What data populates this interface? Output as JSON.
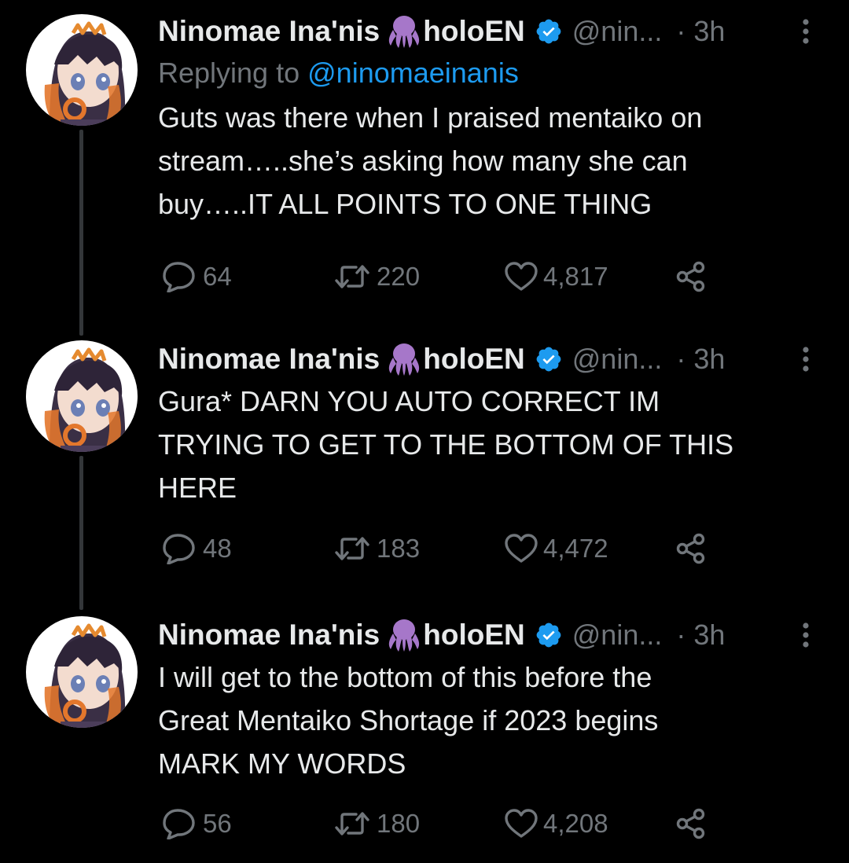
{
  "colors": {
    "background": "#000000",
    "text": "#e7e9ea",
    "muted": "#71767b",
    "accent": "#1d9bf0",
    "thread_line": "#333639",
    "octopus_purple": "#a677c9"
  },
  "tweets": [
    {
      "author": {
        "display_name": "Ninomae Ina'nis",
        "name_emoji": "octopus-emoji",
        "name_suffix": "holoEN",
        "verified_icon": "verified-badge-icon",
        "handle": "@nin...",
        "separator": "·",
        "time": "3h"
      },
      "reply": {
        "prefix": "Replying to",
        "mention": "@ninomaeinanis"
      },
      "text": "Guts was there when I praised mentaiko on\nstream…..she’s asking how many she can\nbuy…..IT ALL POINTS TO ONE THING",
      "actions": {
        "replies": "64",
        "retweets": "220",
        "likes": "4,817"
      }
    },
    {
      "author": {
        "display_name": "Ninomae Ina'nis",
        "name_emoji": "octopus-emoji",
        "name_suffix": "holoEN",
        "verified_icon": "verified-badge-icon",
        "handle": "@nin...",
        "separator": "·",
        "time": "3h"
      },
      "text": "Gura* DARN YOU AUTO CORRECT IM\nTRYING TO GET TO THE BOTTOM OF THIS\nHERE",
      "actions": {
        "replies": "48",
        "retweets": "183",
        "likes": "4,472"
      }
    },
    {
      "author": {
        "display_name": "Ninomae Ina'nis",
        "name_emoji": "octopus-emoji",
        "name_suffix": "holoEN",
        "verified_icon": "verified-badge-icon",
        "handle": "@nin...",
        "separator": "·",
        "time": "3h"
      },
      "text": "I will get to the bottom of this before the\nGreat Mentaiko Shortage if 2023 begins\nMARK MY WORDS",
      "actions": {
        "replies": "56",
        "retweets": "180",
        "likes": "4,208"
      }
    }
  ],
  "icons": {
    "reply": "reply-icon",
    "retweet": "retweet-icon",
    "like": "heart-icon",
    "share": "share-icon",
    "more": "more-vertical-icon"
  }
}
